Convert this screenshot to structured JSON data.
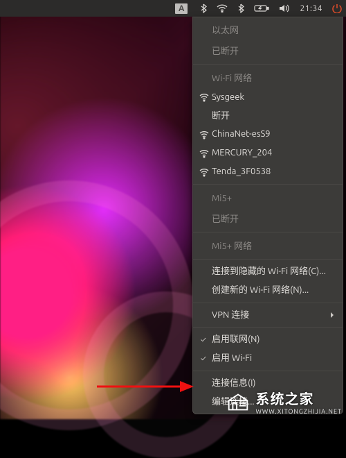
{
  "topbar": {
    "ime": "A",
    "time": "21:34"
  },
  "menu": {
    "ethernet_heading": "以太网",
    "ethernet_status": "已断开",
    "wifi_heading": "Wi-Fi 网络",
    "wifi_connected": "Sysgeek",
    "wifi_disconnect": "断开",
    "wifi_aps": [
      "ChinaNet-esS9",
      "MERCURY_204",
      "Tenda_3F0538"
    ],
    "mi5_heading": "Mi5+",
    "mi5_status": "已断开",
    "mi5_net_heading": "Mi5+ 网络",
    "hidden_wifi": "连接到隐藏的 Wi-Fi 网络(C)...",
    "create_wifi": "创建新的 Wi-Fi 网络(N)...",
    "vpn_heading": "VPN 连接",
    "enable_net": "启用联网(N)",
    "enable_wifi": "启用 Wi-Fi",
    "conn_info": "连接信息(I)",
    "edit_conn": "编辑连接..."
  },
  "watermark": {
    "title": "系统之家",
    "sub": "WWW.XITONGZHIJIA.NET"
  }
}
